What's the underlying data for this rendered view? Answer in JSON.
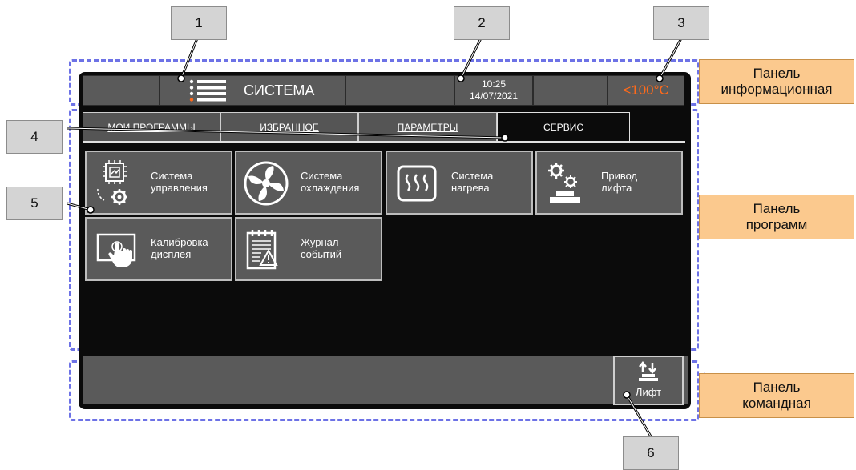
{
  "callouts": [
    "1",
    "2",
    "3",
    "4",
    "5",
    "6"
  ],
  "legends": {
    "info": {
      "line1": "Панель",
      "line2": "информационная"
    },
    "programs": {
      "line1": "Панель",
      "line2": "программ"
    },
    "command": {
      "line1": "Панель",
      "line2": "командная"
    }
  },
  "header": {
    "title": "СИСТЕМА",
    "time": "10:25",
    "date": "14/07/2021",
    "temperature": "<100°C"
  },
  "tabs": [
    "МОИ ПРОГРАММЫ",
    "ИЗБРАННОЕ",
    "ПАРАМЕТРЫ",
    "СЕРВИС"
  ],
  "active_tab": "СЕРВИС",
  "tiles": [
    {
      "label": "Система\nуправления",
      "icon": "chip-gear-icon"
    },
    {
      "label": "Система\nохлаждения",
      "icon": "fan-icon"
    },
    {
      "label": "Система\nнагрева",
      "icon": "heater-icon"
    },
    {
      "label": "Привод\nлифта",
      "icon": "gears-lift-icon"
    },
    {
      "label": "Калибровка\nдисплея",
      "icon": "touch-screen-icon"
    },
    {
      "label": "Журнал\nсобытий",
      "icon": "event-log-icon"
    }
  ],
  "command_bar": {
    "lift_label": "Лифт"
  },
  "colors": {
    "temperature": "#ff6a1a",
    "dash": "#6d72e6",
    "legend": "#fbc98e"
  }
}
